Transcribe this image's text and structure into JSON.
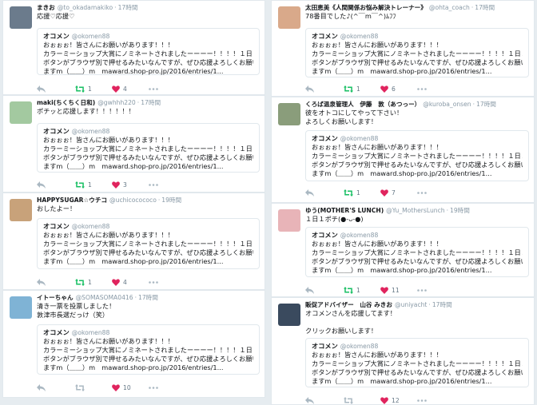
{
  "quote": {
    "name": "オコメン",
    "handle": "@okomen88",
    "lines": [
      "おぉぉぉ！皆さんにお願いがあります！！！",
      "カラーミーショップ大賞にノミネートされましたーーーー！！！！１日１回",
      "ボタンがブラウザ別で押せるみたいなんですが、ぜひ応援よろしくお願いし",
      "ますm（＿＿）m　maward.shop-pro.jp/2016/entries/1..."
    ]
  },
  "colors": {
    "retweet": "#17bf63",
    "like": "#e0245e",
    "muted": "#8899a6",
    "action": "#aab8c2"
  },
  "left_tweets": [
    {
      "name": "まきお",
      "handle": "@to_okadamakiko",
      "time": "17時間",
      "text": "応援♡応援♡",
      "retweets": "1",
      "likes": "4"
    },
    {
      "name": "maki(ちくちく日和)",
      "handle": "@gwhhh220",
      "time": "17時間",
      "text": "ポチッと応援します！！！！！！",
      "retweets": "1",
      "likes": "3"
    },
    {
      "name": "HAPPYSUGAR☆ウチコ",
      "handle": "@uchicocococo",
      "time": "19時間",
      "text": "おしたよー！",
      "retweets": "1",
      "likes": "4"
    },
    {
      "name": "イトーちゃん",
      "handle": "@SOMASOMA0416",
      "time": "17時間",
      "text": "清き一票を投票しました！\n敦津市長選だっけ（笑）",
      "retweets": "",
      "likes": "10"
    }
  ],
  "right_tweets": [
    {
      "name": "太田恵美《人間関係お悩み解決トレーナー》",
      "handle": "@ohta_coach",
      "time": "17時間",
      "text": "78番目でした♪(^￣m￣^)ﾑﾌﾌ",
      "retweets": "1",
      "likes": "6"
    },
    {
      "name": "くろば温泉管理人　伊藤　敦（あつっー）",
      "handle": "@kuroba_onsen",
      "time": "17時間",
      "text": "彼をオトコにしてやって下さい！\nよろしくお願いします！",
      "retweets": "1",
      "likes": "7"
    },
    {
      "name": "ゆう(MOTHER'S LUNCH)",
      "handle": "@Yu_MothersLunch",
      "time": "19時間",
      "text": "１日１ポチ(●‐ᴗ‐●)",
      "retweets": "1",
      "likes": "11"
    },
    {
      "name": "販促アドバイザー　山谷 みきお",
      "handle": "@uniyacht",
      "time": "17時間",
      "text": "オコメンさんを応援してます！\n\nクリックお願いします！",
      "retweets": "",
      "likes": "12"
    }
  ]
}
